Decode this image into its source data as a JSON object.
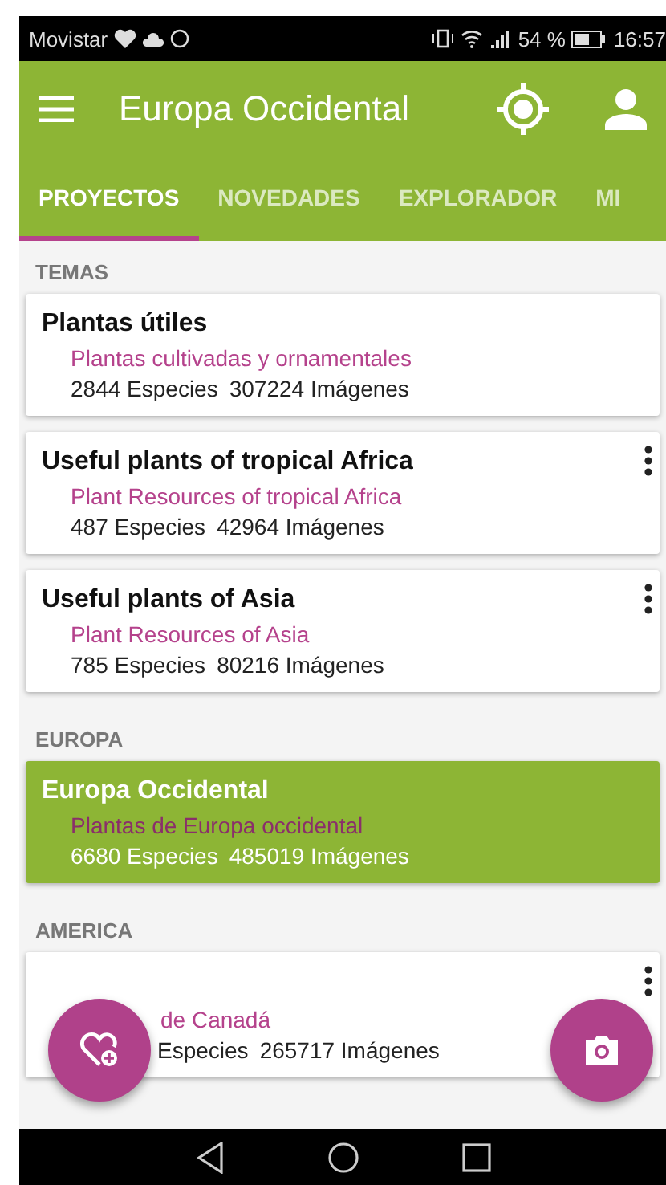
{
  "status_bar": {
    "carrier": "Movistar",
    "battery": "54 %",
    "time": "16:57"
  },
  "app_bar": {
    "title": "Europa Occidental"
  },
  "tabs": [
    {
      "label": "PROYECTOS",
      "selected": true
    },
    {
      "label": "NOVEDADES",
      "selected": false
    },
    {
      "label": "EXPLORADOR",
      "selected": false
    },
    {
      "label": "MI",
      "selected": false
    }
  ],
  "sections": [
    {
      "header": "TEMAS",
      "cards": [
        {
          "kind": "full",
          "title": "Plantas útiles",
          "subtitle": "Plantas cultivadas y ornamentales",
          "species": "2844 Especies",
          "images": "307224 Imágenes",
          "selected": false,
          "menu": false
        },
        {
          "kind": "full",
          "title": "Useful plants of tropical Africa",
          "subtitle": "Plant Resources of tropical Africa",
          "species": "487 Especies",
          "images": "42964 Imágenes",
          "selected": false,
          "menu": true
        },
        {
          "kind": "full",
          "title": "Useful plants of Asia",
          "subtitle": "Plant Resources of Asia",
          "species": "785 Especies",
          "images": "80216 Imágenes",
          "selected": false,
          "menu": true
        }
      ]
    },
    {
      "header": "EUROPA",
      "cards": [
        {
          "kind": "full",
          "title": "Europa Occidental",
          "subtitle": "Plantas de Europa occidental",
          "species": "6680 Especies",
          "images": "485019 Imágenes",
          "selected": true,
          "menu": false
        }
      ]
    },
    {
      "header": "AMERICA",
      "cards": [
        {
          "kind": "covered",
          "subtitle": "de Canadá",
          "species": "Especies",
          "images": "265717 Imágenes",
          "selected": false,
          "menu": true
        }
      ]
    }
  ]
}
